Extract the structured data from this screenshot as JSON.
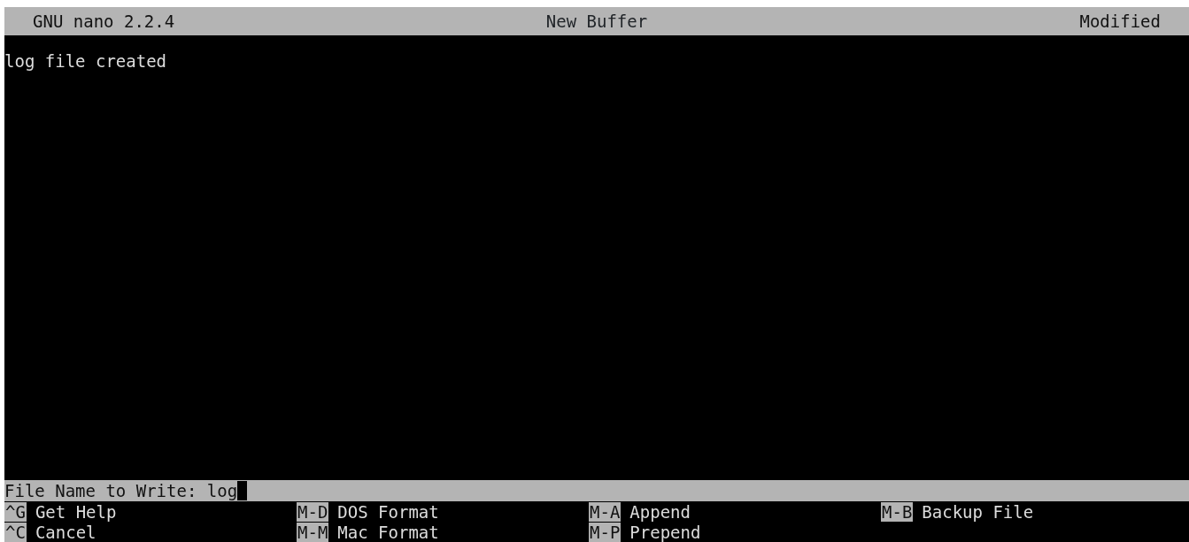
{
  "title_bar": {
    "app": "GNU nano 2.2.4",
    "file": "New Buffer",
    "status": "Modified"
  },
  "buffer": {
    "lines": [
      "log file created"
    ]
  },
  "prompt": {
    "label": "File Name to Write:",
    "value": "log"
  },
  "shortcut_rows": [
    [
      {
        "key": "^G",
        "label": "Get Help"
      },
      {
        "key": "M-D",
        "label": "DOS Format"
      },
      {
        "key": "M-A",
        "label": "Append"
      },
      {
        "key": "M-B",
        "label": "Backup File"
      }
    ],
    [
      {
        "key": "^C",
        "label": "Cancel"
      },
      {
        "key": "M-M",
        "label": "Mac Format"
      },
      {
        "key": "M-P",
        "label": "Prepend"
      }
    ]
  ]
}
